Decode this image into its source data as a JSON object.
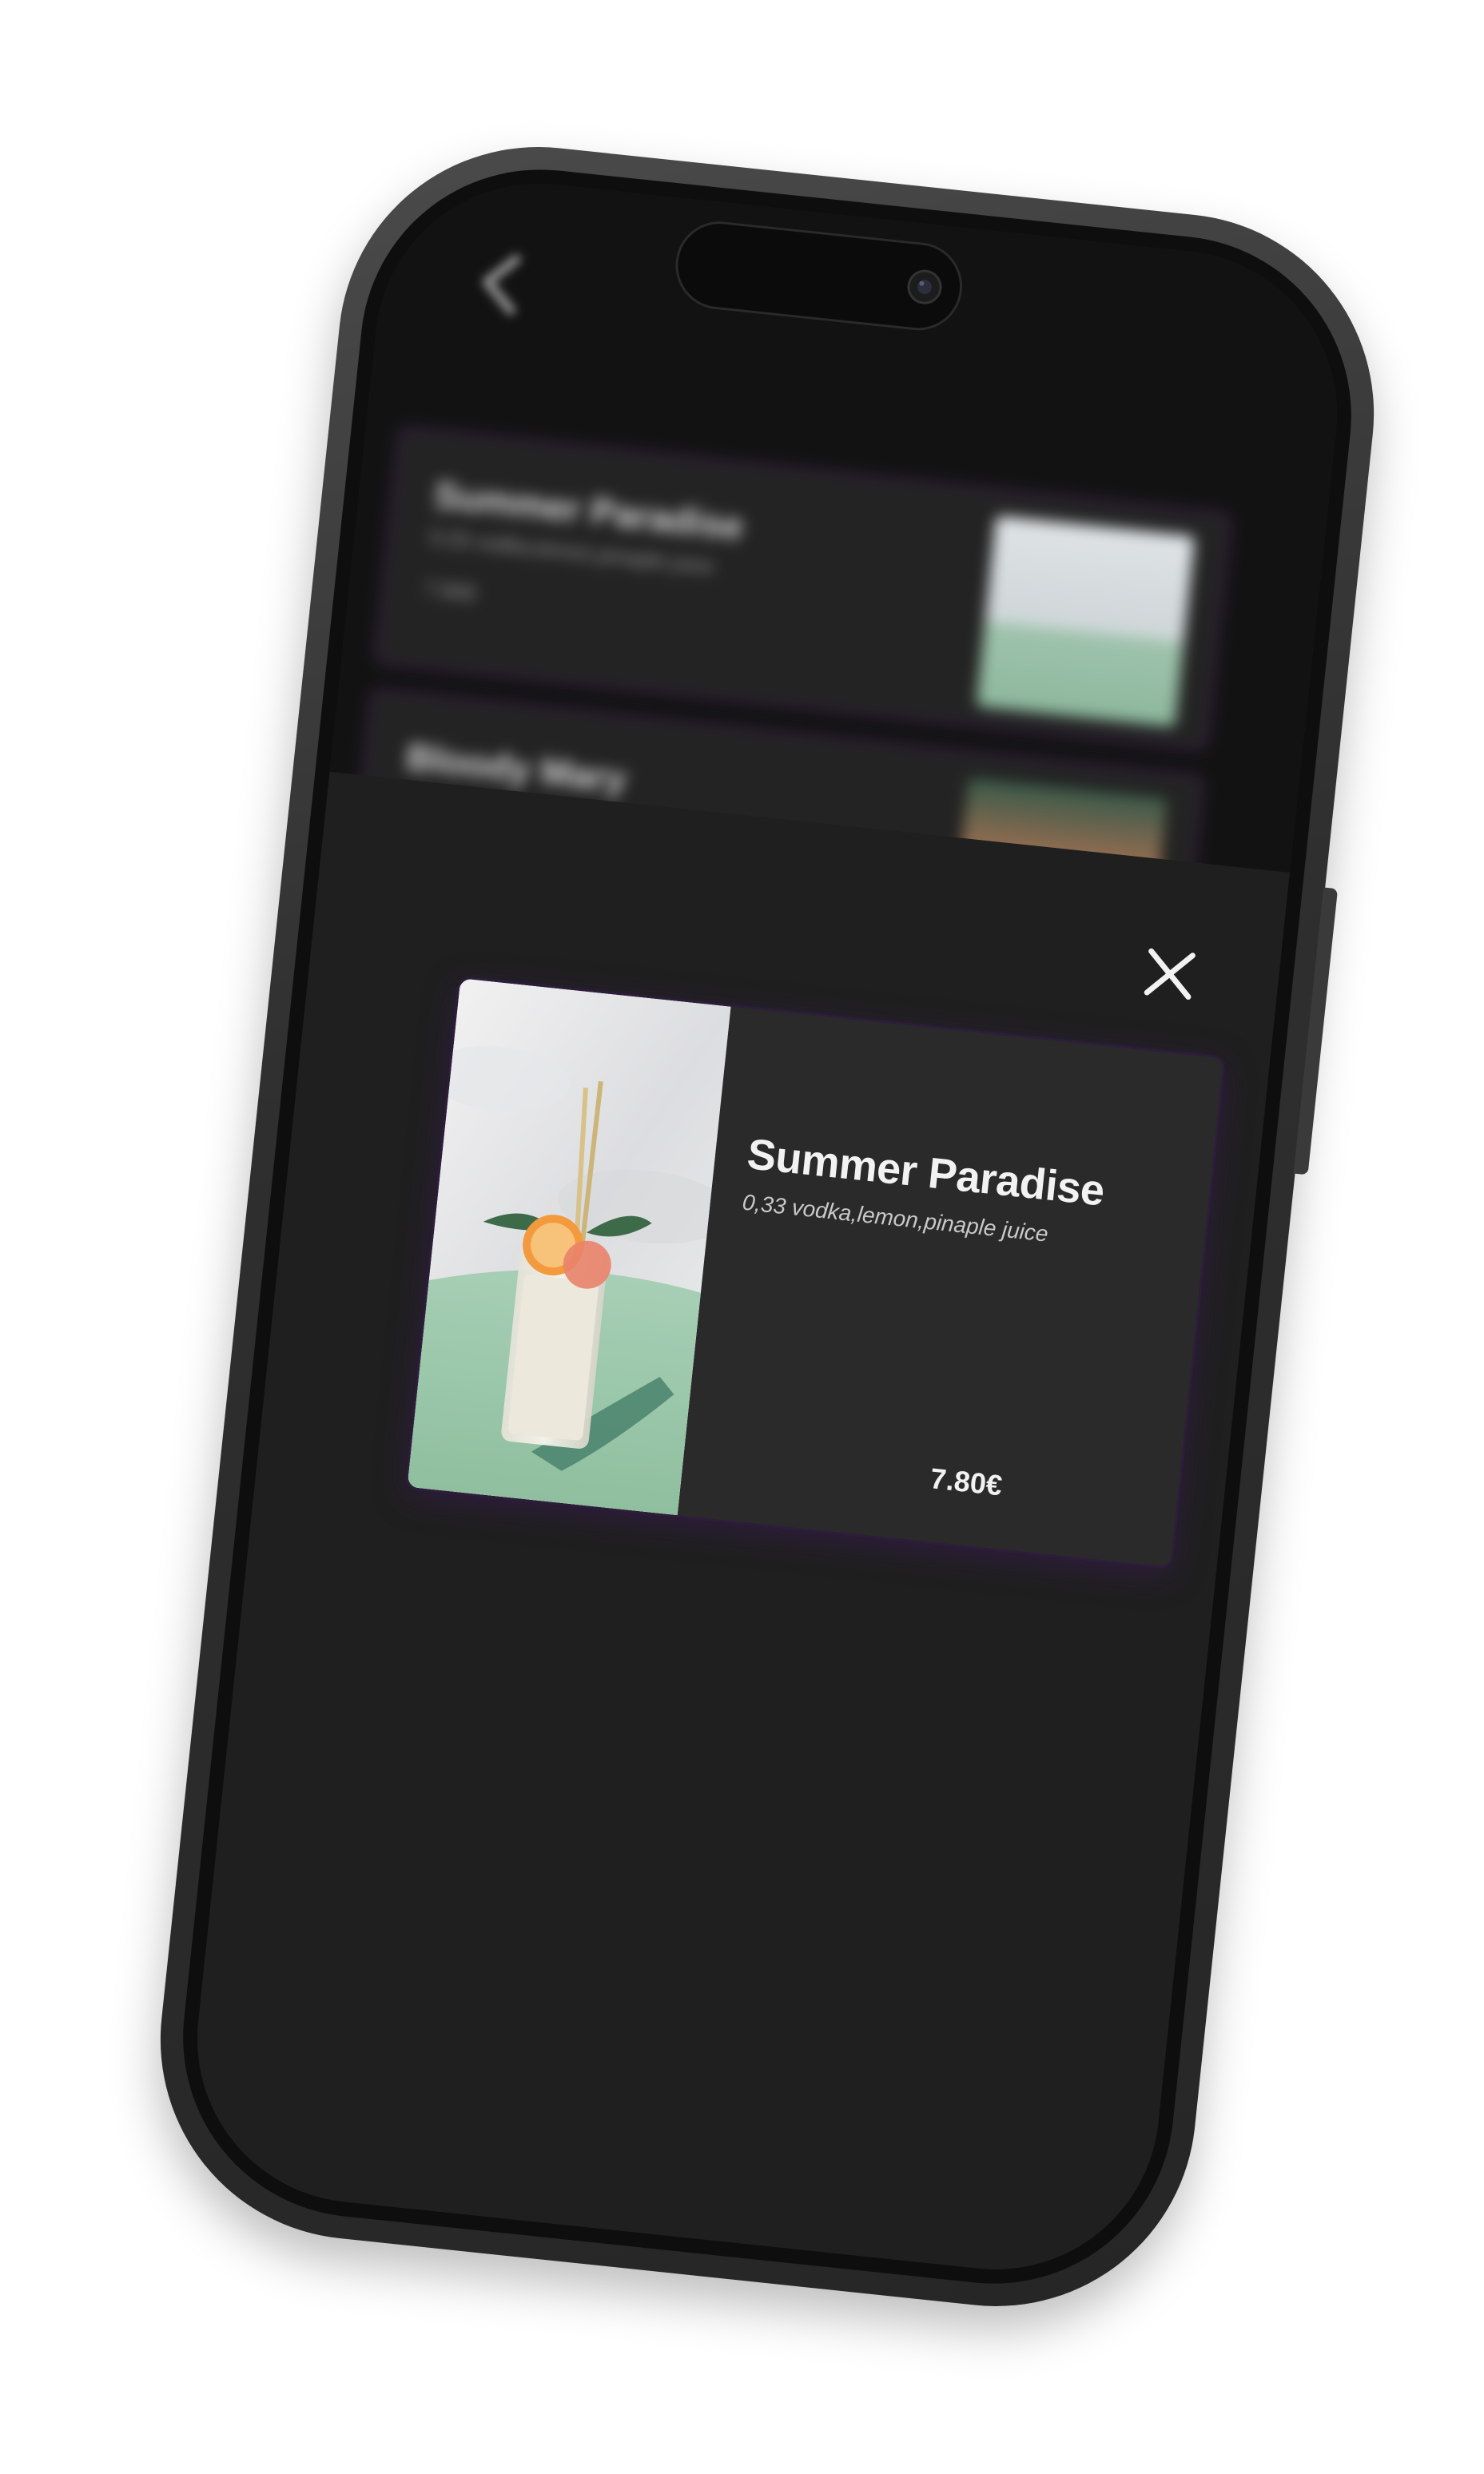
{
  "background_list": {
    "items": [
      {
        "title": "Summer Paradise",
        "description": "0,33 vodka,lemon,pinaple juice",
        "price": "7.80€"
      },
      {
        "title": "Bloody Mary",
        "description": "",
        "price": ""
      }
    ]
  },
  "product_detail": {
    "title": "Summer Paradise",
    "description": "0,33 vodka,lemon,pinaple juice",
    "price": "7.80€"
  },
  "icons": {
    "back": "chevron-left-icon",
    "close": "close-icon",
    "camera": "camera-icon"
  },
  "colors": {
    "screen_background": "#1f1f1f",
    "card_background": "#2a2a2a",
    "card_glow": "#3e195c",
    "text_primary": "#f2f2f2",
    "text_secondary": "#c9c9c9"
  }
}
